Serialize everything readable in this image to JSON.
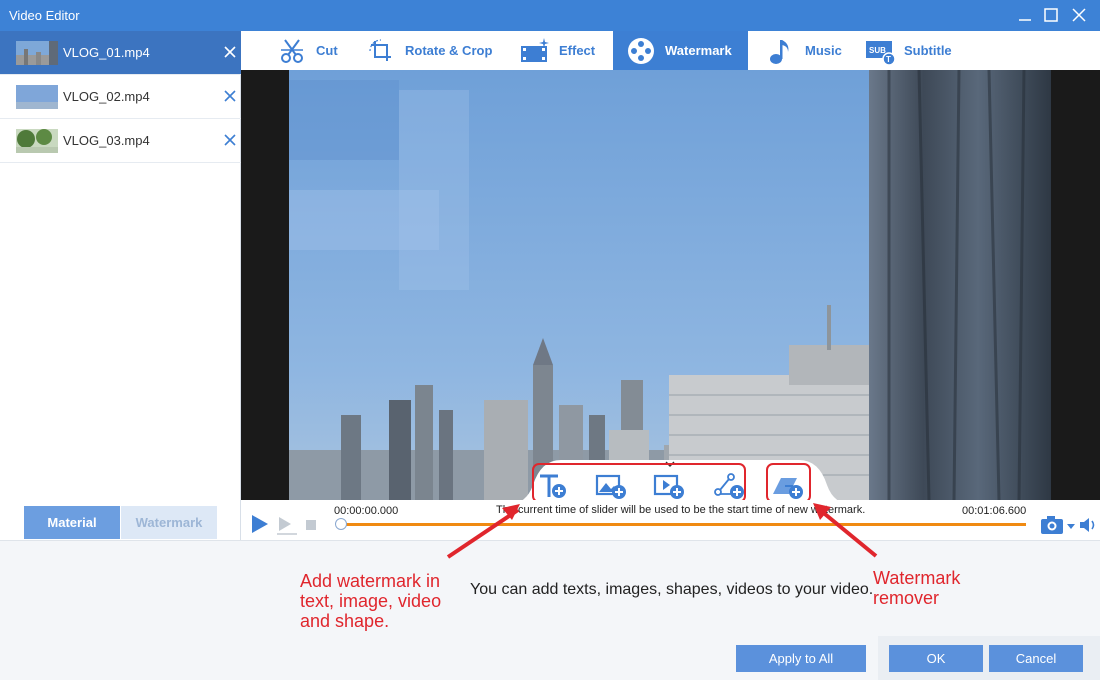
{
  "window": {
    "title": "Video Editor"
  },
  "files": [
    {
      "name": "VLOG_01.mp4",
      "active": true
    },
    {
      "name": "VLOG_02.mp4",
      "active": false
    },
    {
      "name": "VLOG_03.mp4",
      "active": false
    }
  ],
  "left_buttons": {
    "material": "Material",
    "watermark": "Watermark"
  },
  "tabs": [
    {
      "label": "Cut",
      "icon": "scissors-icon"
    },
    {
      "label": "Rotate & Crop",
      "icon": "crop-icon"
    },
    {
      "label": "Effect",
      "icon": "effect-icon"
    },
    {
      "label": "Watermark",
      "icon": "film-reel-icon",
      "active": true
    },
    {
      "label": "Music",
      "icon": "music-note-icon"
    },
    {
      "label": "Subtitle",
      "icon": "subtitle-icon"
    }
  ],
  "timeline": {
    "start": "00:00:00.000",
    "end": "00:01:06.600",
    "hint": "The current time of slider will be used to be the start time of new watermark."
  },
  "tools": [
    "add-text-watermark",
    "add-image-watermark",
    "add-video-watermark",
    "add-shape-watermark",
    "watermark-remover"
  ],
  "info": "You can add texts, images, shapes, videos to your video.",
  "annotations": {
    "left": [
      "Add watermark in",
      "text, image, video",
      "and shape."
    ],
    "right": [
      "Watermark",
      "remover"
    ]
  },
  "buttons": {
    "apply_all": "Apply to All",
    "ok": "OK",
    "cancel": "Cancel"
  },
  "colors": {
    "accent": "#3d82d6",
    "timeline": "#f08a12",
    "annotation": "#e0262d"
  }
}
